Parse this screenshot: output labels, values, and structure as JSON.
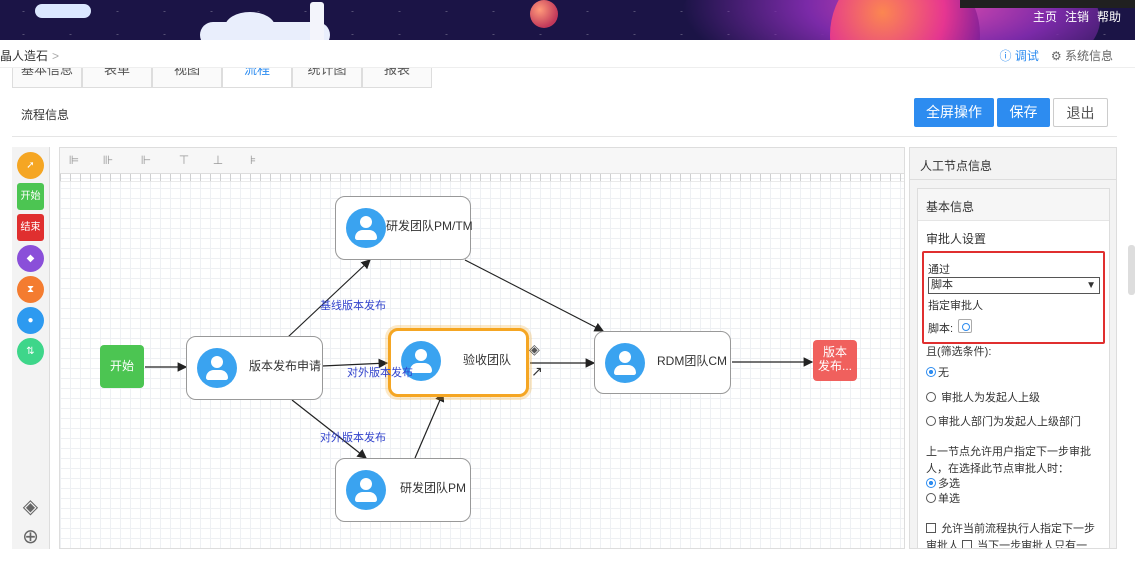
{
  "header": {
    "links": [
      "主页",
      "注销",
      "帮助"
    ]
  },
  "breadcrumb": {
    "current": "晶人造石",
    "separator": ">",
    "debug": "调试",
    "sysinfo": "系统信息"
  },
  "tabs": [
    {
      "label": "基本信息",
      "active": false
    },
    {
      "label": "表单",
      "active": false
    },
    {
      "label": "视图",
      "active": false
    },
    {
      "label": "流程",
      "active": true
    },
    {
      "label": "统计图",
      "active": false
    },
    {
      "label": "报表",
      "active": false
    }
  ],
  "section": {
    "title": "流程信息"
  },
  "actions": {
    "fullscreen": "全屏操作",
    "save": "保存",
    "exit": "退出"
  },
  "palette": {
    "start": "开始",
    "end": "结束"
  },
  "flow": {
    "start": "开始",
    "end": "版本发布...",
    "nodes": {
      "apply": "版本发布申请",
      "pmtm": "研发团队PM/TM",
      "accept": "验收团队",
      "rdm": "RDM团队CM",
      "pm": "研发团队PM"
    },
    "edges": {
      "baseline": "基线版本发布",
      "external1": "对外版本发布",
      "external2": "对外版本发布"
    }
  },
  "panel": {
    "title": "人工节点信息",
    "basic": "基本信息",
    "approver": "审批人设置",
    "pass": "通过",
    "select_value": "脚本",
    "assign": "指定审批人",
    "script_label": "脚本:",
    "filter": "且(筛选条件):",
    "radio_none": "无",
    "radio_superior": "审批人为发起人上级",
    "radio_dept": "审批人部门为发起人上级部门",
    "prev_line1": "上一节点允许用户指定下一步审批",
    "prev_line2": "人，在选择此节点审批人时：",
    "multi": "多选",
    "single": "单选",
    "allow_line1": "允许当前流程执行人指定下一步",
    "allow_line2a": "审批人",
    "allow_line2b": "当下一步审批人只有一"
  }
}
